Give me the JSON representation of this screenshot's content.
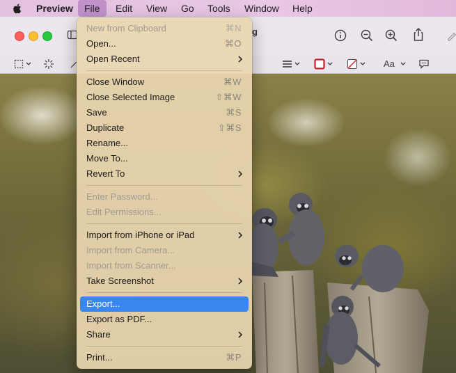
{
  "menubar": {
    "items": [
      {
        "label": "Preview"
      },
      {
        "label": "File"
      },
      {
        "label": "Edit"
      },
      {
        "label": "View"
      },
      {
        "label": "Go"
      },
      {
        "label": "Tools"
      },
      {
        "label": "Window"
      },
      {
        "label": "Help"
      }
    ]
  },
  "window": {
    "title_fragment": "g"
  },
  "file_menu": {
    "items": [
      {
        "label": "New from Clipboard",
        "shortcut": "⌘N",
        "disabled": true
      },
      {
        "label": "Open...",
        "shortcut": "⌘O"
      },
      {
        "label": "Open Recent",
        "submenu": true
      },
      {
        "label": "Close Window",
        "shortcut": "⌘W"
      },
      {
        "label": "Close Selected Image",
        "shortcut": "⇧⌘W"
      },
      {
        "label": "Save",
        "shortcut": "⌘S"
      },
      {
        "label": "Duplicate",
        "shortcut": "⇧⌘S"
      },
      {
        "label": "Rename..."
      },
      {
        "label": "Move To..."
      },
      {
        "label": "Revert To",
        "submenu": true
      },
      {
        "label": "Enter Password...",
        "disabled": true
      },
      {
        "label": "Edit Permissions...",
        "disabled": true
      },
      {
        "label": "Import from iPhone or iPad",
        "submenu": true
      },
      {
        "label": "Import from Camera...",
        "disabled": true
      },
      {
        "label": "Import from Scanner...",
        "disabled": true
      },
      {
        "label": "Take Screenshot",
        "submenu": true
      },
      {
        "label": "Export...",
        "selected": true
      },
      {
        "label": "Export as PDF..."
      },
      {
        "label": "Share",
        "submenu": true
      },
      {
        "label": "Print...",
        "shortcut": "⌘P"
      }
    ]
  },
  "toolbar": {
    "text_style_label": "Aa"
  },
  "colors": {
    "selection": "#3a86f1",
    "menubar": "#e8c7e4"
  }
}
